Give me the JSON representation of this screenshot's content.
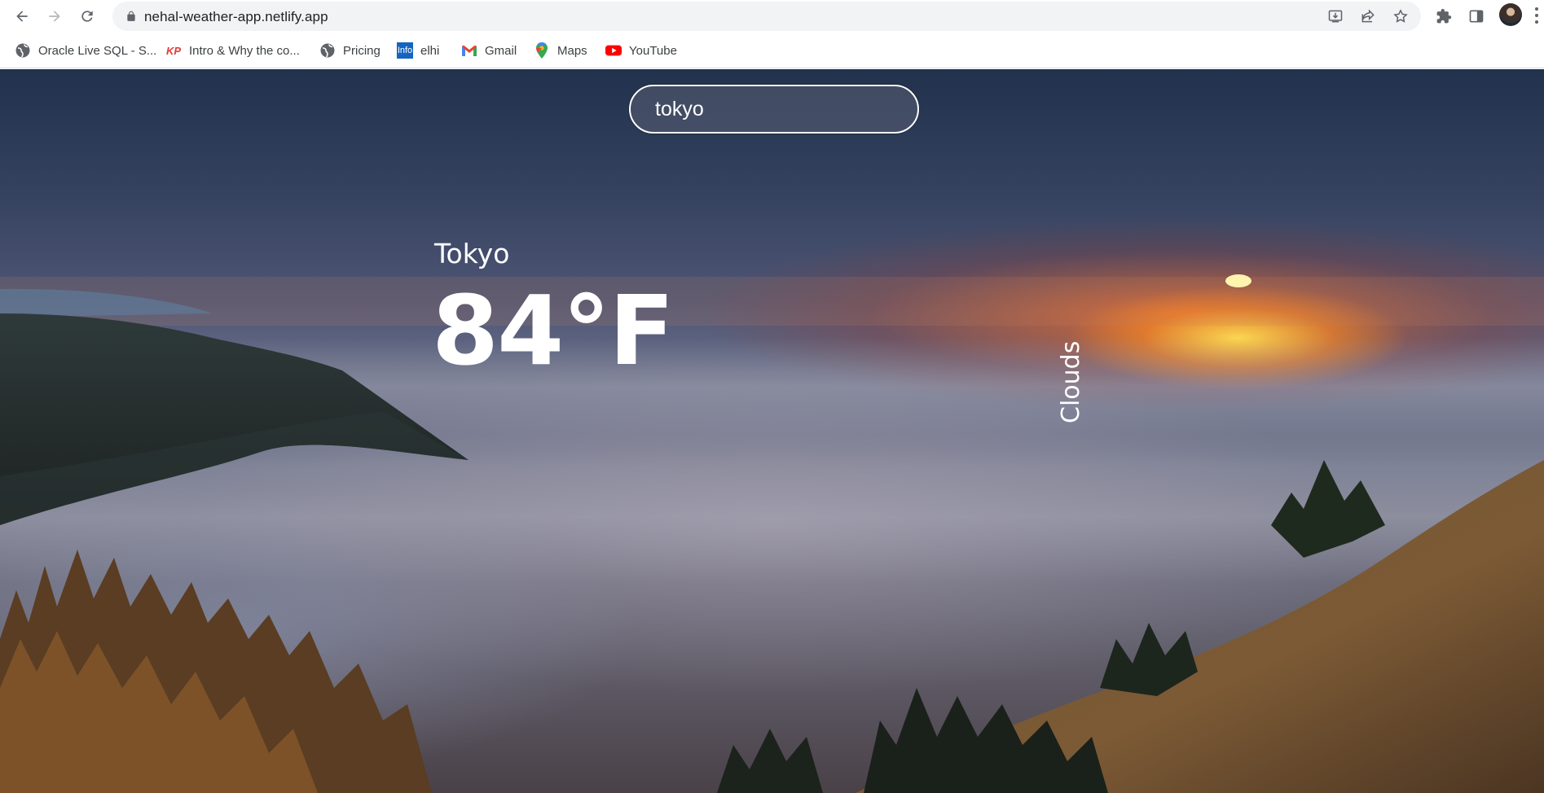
{
  "browser": {
    "url": "nehal-weather-app.netlify.app",
    "icons": [
      "back-icon",
      "forward-icon",
      "reload-icon",
      "lock-icon",
      "install-app-icon",
      "share-icon",
      "bookmark-star-icon",
      "extensions-icon",
      "side-panel-icon",
      "profile-avatar",
      "more-menu-icon"
    ],
    "bookmarks": [
      {
        "label": "Oracle Live SQL - S...",
        "icon": "globe-icon"
      },
      {
        "label": "Intro & Why the co...",
        "icon": "kp-icon"
      },
      {
        "label": "Pricing",
        "icon": "globe-icon"
      },
      {
        "label": "elhi",
        "icon": "info-icon"
      },
      {
        "label": "Gmail",
        "icon": "gmail-icon"
      },
      {
        "label": "Maps",
        "icon": "maps-icon"
      },
      {
        "label": "YouTube",
        "icon": "youtube-icon"
      }
    ],
    "favicon_text": {
      "kp": "KP",
      "info": "Info"
    }
  },
  "app": {
    "search": {
      "value": "tokyo",
      "placeholder": ""
    },
    "city": "Tokyo",
    "temperature": "84°F",
    "condition": "Clouds"
  },
  "colors": {
    "text": "#ffffff",
    "sun": "#ffd34d",
    "sky_top": "#2d3f58"
  }
}
